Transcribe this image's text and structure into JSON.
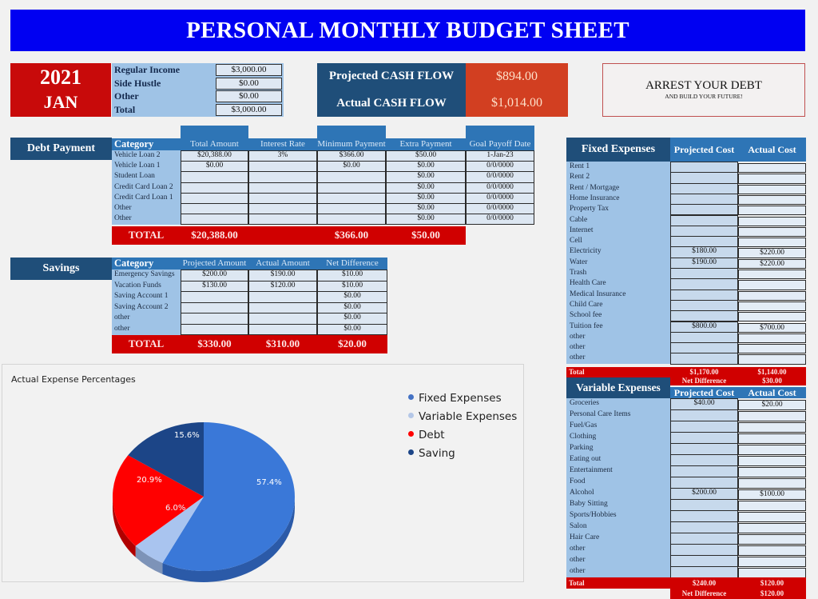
{
  "title": "PERSONAL MONTHLY BUDGET SHEET",
  "period": {
    "year": "2021",
    "month": "JAN"
  },
  "income": [
    {
      "label": "Regular Income",
      "value": "$3,000.00"
    },
    {
      "label": "Side Hustle",
      "value": "$0.00"
    },
    {
      "label": "Other",
      "value": "$0.00"
    },
    {
      "label": "Total",
      "value": "$3,000.00"
    }
  ],
  "cash_flow": {
    "projected_label": "Projected CASH FLOW",
    "projected_value": "$894.00",
    "actual_label": "Actual CASH FLOW",
    "actual_value": "$1,014.00"
  },
  "slogan": {
    "main": "ARREST YOUR DEBT",
    "sub": "AND BUILD YOUR FUTURE!"
  },
  "debt": {
    "title": "Debt Payment",
    "headers": {
      "category": "Category",
      "total_amount": "Total Amount",
      "interest_rate": "Interest Rate",
      "minimum_payment": "Minimum Payment",
      "extra_payment": "Extra Payment",
      "goal_date": "Goal Payoff Date"
    },
    "rows": [
      {
        "category": "Vehicle Loan 2",
        "total": "$20,388.00",
        "rate": "3%",
        "minimum": "$366.00",
        "extra": "$50.00",
        "goal": "1-Jan-23"
      },
      {
        "category": "Vehicle Loan 1",
        "total": "$0.00",
        "rate": "",
        "minimum": "$0.00",
        "extra": "$0.00",
        "goal": "0/0/0000"
      },
      {
        "category": "Student Loan",
        "total": "",
        "rate": "",
        "minimum": "",
        "extra": "$0.00",
        "goal": "0/0/0000"
      },
      {
        "category": "Credit Card Loan 2",
        "total": "",
        "rate": "",
        "minimum": "",
        "extra": "$0.00",
        "goal": "0/0/0000"
      },
      {
        "category": "Credit Card Loan 1",
        "total": "",
        "rate": "",
        "minimum": "",
        "extra": "$0.00",
        "goal": "0/0/0000"
      },
      {
        "category": "Other",
        "total": "",
        "rate": "",
        "minimum": "",
        "extra": "$0.00",
        "goal": "0/0/0000"
      },
      {
        "category": "Other",
        "total": "",
        "rate": "",
        "minimum": "",
        "extra": "$0.00",
        "goal": "0/0/0000"
      }
    ],
    "total": {
      "label": "TOTAL",
      "total": "$20,388.00",
      "minimum": "$366.00",
      "extra": "$50.00"
    }
  },
  "savings": {
    "title": "Savings",
    "headers": {
      "category": "Category",
      "projected": "Projected Amount",
      "actual": "Actual Amount",
      "net": "Net Difference"
    },
    "rows": [
      {
        "category": "Emergency Savings",
        "projected": "$200.00",
        "actual": "$190.00",
        "net": "$10.00"
      },
      {
        "category": "Vacation Funds",
        "projected": "$130.00",
        "actual": "$120.00",
        "net": "$10.00"
      },
      {
        "category": "Saving Account 1",
        "projected": "",
        "actual": "",
        "net": "$0.00"
      },
      {
        "category": "Saving Account 2",
        "projected": "",
        "actual": "",
        "net": "$0.00"
      },
      {
        "category": "other",
        "projected": "",
        "actual": "",
        "net": "$0.00"
      },
      {
        "category": "other",
        "projected": "",
        "actual": "",
        "net": "$0.00"
      }
    ],
    "total": {
      "label": "TOTAL",
      "projected": "$330.00",
      "actual": "$310.00",
      "net": "$20.00"
    }
  },
  "fixed": {
    "title": "Fixed Expenses",
    "projected_header": "Projected Cost",
    "actual_header": "Actual Cost",
    "rows": [
      {
        "category": "Rent 1",
        "projected": "",
        "actual": ""
      },
      {
        "category": "Rent 2",
        "projected": "",
        "actual": ""
      },
      {
        "category": "Rent / Mortgage",
        "projected": "",
        "actual": ""
      },
      {
        "category": "Home Insurance",
        "projected": "",
        "actual": ""
      },
      {
        "category": "Property Tax",
        "projected": "",
        "actual": ""
      },
      {
        "category": "Cable",
        "projected": "",
        "actual": ""
      },
      {
        "category": "Internet",
        "projected": "",
        "actual": ""
      },
      {
        "category": "Cell",
        "projected": "",
        "actual": ""
      },
      {
        "category": "Electricity",
        "projected": "$180.00",
        "actual": "$220.00"
      },
      {
        "category": "Water",
        "projected": "$190.00",
        "actual": "$220.00"
      },
      {
        "category": "Trash",
        "projected": "",
        "actual": ""
      },
      {
        "category": "Health Care",
        "projected": "",
        "actual": ""
      },
      {
        "category": "Medical Insurance",
        "projected": "",
        "actual": ""
      },
      {
        "category": "Child Care",
        "projected": "",
        "actual": ""
      },
      {
        "category": "School fee",
        "projected": "",
        "actual": ""
      },
      {
        "category": "Tuition fee",
        "projected": "$800.00",
        "actual": "$700.00"
      },
      {
        "category": "other",
        "projected": "",
        "actual": ""
      },
      {
        "category": "other",
        "projected": "",
        "actual": ""
      },
      {
        "category": "other",
        "projected": "",
        "actual": ""
      }
    ],
    "total": {
      "label": "Total",
      "projected": "$1,170.00",
      "actual": "$1,140.00",
      "net_label": "Net Difference",
      "net": "$30.00"
    }
  },
  "variable": {
    "title": "Variable Expenses",
    "projected_header": "Projected Cost",
    "actual_header": "Actual Cost",
    "rows": [
      {
        "category": "Groceries",
        "projected": "$40.00",
        "actual": "$20.00"
      },
      {
        "category": "Personal Care Items",
        "projected": "",
        "actual": ""
      },
      {
        "category": "Fuel/Gas",
        "projected": "",
        "actual": ""
      },
      {
        "category": "Clothing",
        "projected": "",
        "actual": ""
      },
      {
        "category": "Parking",
        "projected": "",
        "actual": ""
      },
      {
        "category": "Eating out",
        "projected": "",
        "actual": ""
      },
      {
        "category": "Entertainment",
        "projected": "",
        "actual": ""
      },
      {
        "category": "Food",
        "projected": "",
        "actual": ""
      },
      {
        "category": "Alcohol",
        "projected": "$200.00",
        "actual": "$100.00"
      },
      {
        "category": "Baby Sitting",
        "projected": "",
        "actual": ""
      },
      {
        "category": "Sports/Hobbies",
        "projected": "",
        "actual": ""
      },
      {
        "category": "Salon",
        "projected": "",
        "actual": ""
      },
      {
        "category": "Hair Care",
        "projected": "",
        "actual": ""
      },
      {
        "category": "other",
        "projected": "",
        "actual": ""
      },
      {
        "category": "other",
        "projected": "",
        "actual": ""
      },
      {
        "category": "other",
        "projected": "",
        "actual": ""
      }
    ],
    "total": {
      "label": "Total",
      "projected": "$240.00",
      "actual": "$120.00",
      "net_label": "Net Difference",
      "net": "$120.00"
    }
  },
  "colors": {
    "title_bar": "#0000f2",
    "section_header": "#1f4e79",
    "column_header": "#2e75b6",
    "total_bar": "#d00000",
    "cash_value": "#d23f21"
  },
  "chart_data": {
    "type": "pie",
    "title": "Actual Expense Percentages",
    "categories": [
      "Fixed Expenses",
      "Variable Expenses",
      "Debt",
      "Saving"
    ],
    "values": [
      57.4,
      6.0,
      20.9,
      15.6
    ],
    "labels": [
      "57.4%",
      "6.0%",
      "20.9%",
      "15.6%"
    ],
    "colors": [
      "#3a78d8",
      "#a9c4ef",
      "#ff0000",
      "#1c4587"
    ],
    "legend_position": "right",
    "style": "3d"
  }
}
